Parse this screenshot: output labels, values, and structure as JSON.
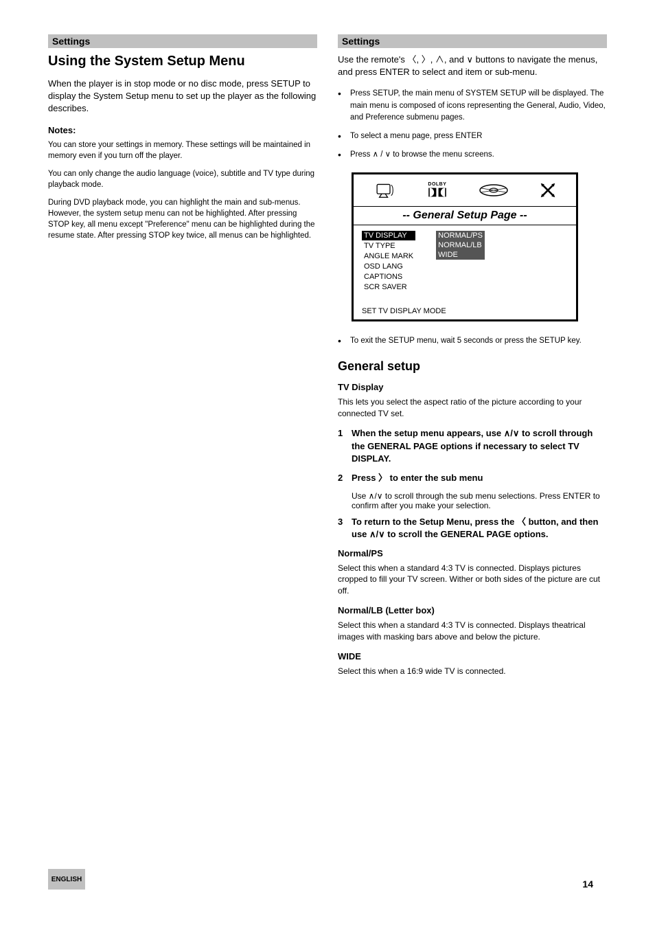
{
  "pageNumber": "14",
  "langTab": "ENGLISH",
  "left": {
    "headerTitle": "Settings",
    "title": "Using the System Setup Menu",
    "intro": "When the player is in stop mode or no disc mode, press SETUP to display the System Setup menu to set up the player as the following describes.",
    "notesLabel": "Notes:",
    "notes": [
      "You can store your settings in memory. These settings will be maintained in memory even if you turn off the player.",
      "You can only change the audio language (voice), subtitle and TV type during playback mode.",
      "During DVD playback mode, you can highlight the main and sub-menus. However, the system setup menu can not be highlighted. After pressing STOP key, all menu except \"Preference\" menu can be highlighted during the resume state. After pressing STOP key twice, all menus can be highlighted."
    ]
  },
  "right": {
    "headerTitle": "Settings",
    "topParagraph": "Use the remote's 〈, 〉, ∧, and ∨ buttons to navigate the menus, and press ENTER to select and item or sub-menu.",
    "bullets": {
      "b1": "Press SETUP, the main menu of SYSTEM SETUP will be displayed. The main menu is composed of icons representing the General, Audio, Video, and Preference submenu pages.",
      "b2": "To select a menu page, press ENTER",
      "b3": "Press ∧ / ∨ to browse the menu screens."
    },
    "menu": {
      "title": "-- General  Setup  Page --",
      "leftItems": [
        "TV DISPLAY",
        "TV TYPE",
        "ANGLE MARK",
        "OSD LANG",
        "CAPTIONS",
        "SCR SAVER"
      ],
      "rightItems": [
        "NORMAL/PS",
        "NORMAL/LB",
        "WIDE"
      ],
      "status": "SET TV DISPLAY MODE"
    },
    "paragraphAfterMenu": "To exit the SETUP menu, wait 5 seconds or press the SETUP key.",
    "generalTitle": "General setup",
    "tvDisplayLabel": "TV Display",
    "tvDisplayText": "This lets you select the aspect ratio of the picture according to your connected TV set.",
    "steps": {
      "s1": "When the setup menu appears, use ∧/∨ to scroll through the GENERAL PAGE options if necessary to select TV DISPLAY.",
      "s2": "Press 〉 to enter the sub menu",
      "s2sub": "Use ∧/∨ to scroll through the sub menu selections. Press ENTER to confirm after you make your selection.",
      "s3": "To return to the Setup Menu, press the 〈 button, and then use ∧/∨ to scroll the GENERAL PAGE options."
    },
    "normalPsLabel": "Normal/PS",
    "normalPsText": "Select this when a standard 4:3 TV is connected. Displays pictures cropped to fill your TV screen. Wither or both sides of the picture are cut off.",
    "normalLbLabel": "Normal/LB (Letter box)",
    "normalLbText": "Select this when a standard 4:3 TV is connected. Displays theatrical images with masking bars above and below the picture.",
    "wideLabel": "WIDE",
    "wideText": "Select this when a 16:9 wide TV is connected."
  }
}
